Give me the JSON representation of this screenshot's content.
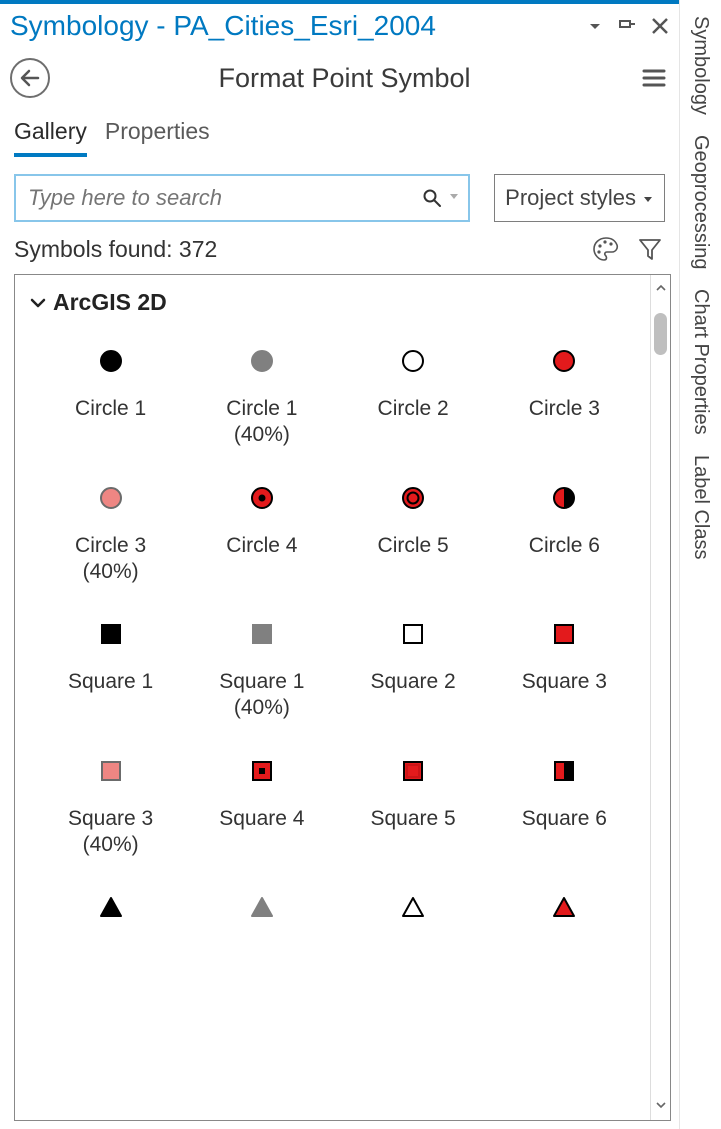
{
  "colors": {
    "accent": "#0079c1",
    "red": "#e31a1c",
    "red40": "#ee8683",
    "gray40": "#808080"
  },
  "titlebar": {
    "title": "Symbology - PA_Cities_Esri_2004"
  },
  "header": {
    "title": "Format Point Symbol"
  },
  "tabs": [
    {
      "label": "Gallery",
      "active": true
    },
    {
      "label": "Properties",
      "active": false
    }
  ],
  "search": {
    "placeholder": "Type here to search",
    "value": ""
  },
  "styles_dropdown": {
    "label": "Project styles"
  },
  "status": {
    "found_label": "Symbols found: 372"
  },
  "gallery": {
    "category_label": "ArcGIS 2D",
    "items": [
      {
        "label": "Circle 1",
        "glyph": "circle",
        "fill": "#000000",
        "stroke": "#000000"
      },
      {
        "label": "Circle 1 (40%)",
        "glyph": "circle",
        "fill": "#808080",
        "stroke": "#808080"
      },
      {
        "label": "Circle 2",
        "glyph": "circle",
        "fill": "none",
        "stroke": "#000000"
      },
      {
        "label": "Circle 3",
        "glyph": "circle",
        "fill": "#e31a1c",
        "stroke": "#000000"
      },
      {
        "label": "Circle 3 (40%)",
        "glyph": "circle",
        "fill": "#ee8683",
        "stroke": "#6b6b6b"
      },
      {
        "label": "Circle 4",
        "glyph": "circle-dot",
        "fill": "#e31a1c",
        "stroke": "#000000",
        "dot": "#000000"
      },
      {
        "label": "Circle 5",
        "glyph": "circle-ring",
        "fill": "#e31a1c",
        "stroke": "#000000",
        "ring": "#e31a1c"
      },
      {
        "label": "Circle 6",
        "glyph": "circle-half",
        "fill": "#e31a1c",
        "stroke": "#000000",
        "half": "#000000"
      },
      {
        "label": "Square 1",
        "glyph": "square",
        "fill": "#000000",
        "stroke": "#000000"
      },
      {
        "label": "Square 1 (40%)",
        "glyph": "square",
        "fill": "#808080",
        "stroke": "#808080"
      },
      {
        "label": "Square 2",
        "glyph": "square",
        "fill": "none",
        "stroke": "#000000"
      },
      {
        "label": "Square 3",
        "glyph": "square",
        "fill": "#e31a1c",
        "stroke": "#000000"
      },
      {
        "label": "Square 3 (40%)",
        "glyph": "square",
        "fill": "#ee8683",
        "stroke": "#6b6b6b"
      },
      {
        "label": "Square 4",
        "glyph": "square-dot",
        "fill": "#e31a1c",
        "stroke": "#000000",
        "dot": "#000000"
      },
      {
        "label": "Square 5",
        "glyph": "square-inset",
        "fill": "#e31a1c",
        "stroke": "#000000",
        "inset": "#cc1417"
      },
      {
        "label": "Square 6",
        "glyph": "square-half",
        "fill": "#e31a1c",
        "stroke": "#000000",
        "half": "#000000"
      },
      {
        "label": "",
        "glyph": "triangle",
        "fill": "#000000",
        "stroke": "#000000"
      },
      {
        "label": "",
        "glyph": "triangle",
        "fill": "#808080",
        "stroke": "#808080"
      },
      {
        "label": "",
        "glyph": "triangle",
        "fill": "none",
        "stroke": "#000000"
      },
      {
        "label": "",
        "glyph": "triangle",
        "fill": "#e31a1c",
        "stroke": "#000000"
      }
    ]
  },
  "right_dock": [
    "Symbology",
    "Geoprocessing",
    "Chart Properties",
    "Label Class"
  ]
}
